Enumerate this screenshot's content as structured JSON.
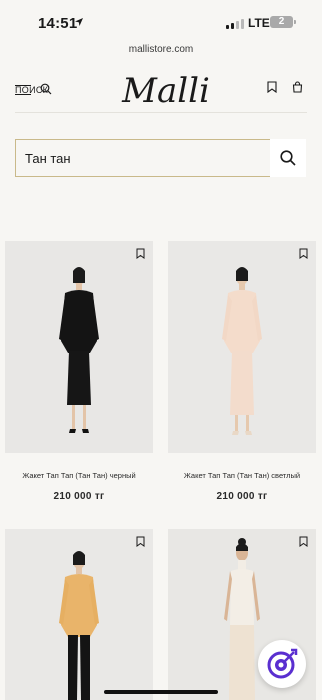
{
  "status_bar": {
    "time": "14:51",
    "network": "LTE",
    "battery": "2"
  },
  "browser": {
    "url": "mallistore.com"
  },
  "header": {
    "menu_label": "ПОИСК",
    "logo_text": "Malli"
  },
  "search": {
    "value": "Тан тан"
  },
  "products": [
    {
      "title": "Жакет Тап Тап (Тан Тан) черный",
      "price": "210 000 тг",
      "outfit": "black"
    },
    {
      "title": "Жакет Тап Тап (Тан Тан) светлый",
      "price": "210 000 тг",
      "outfit": "cream"
    },
    {
      "title": "",
      "price": "",
      "outfit": "mustard"
    },
    {
      "title": "",
      "price": "",
      "outfit": "ivory"
    }
  ],
  "colors": {
    "accent_border": "#c9b98a",
    "background": "#f7f6f3",
    "fab_accent": "#5a2fd0"
  }
}
